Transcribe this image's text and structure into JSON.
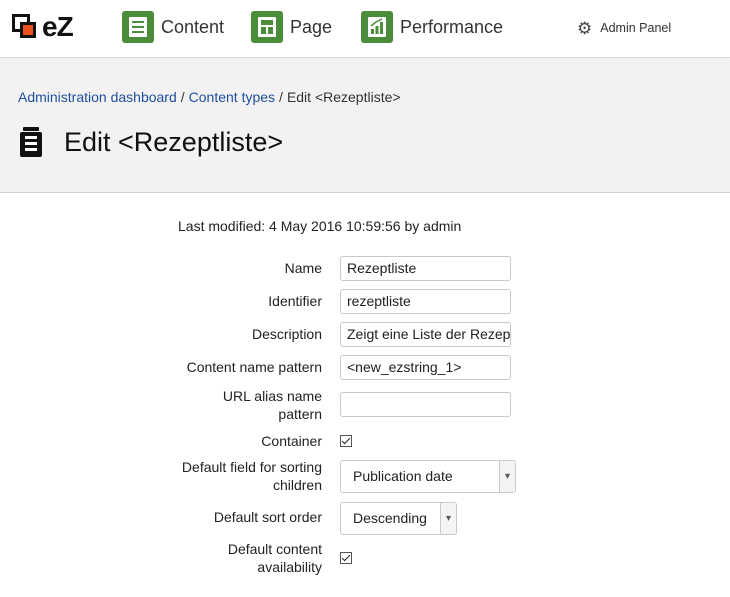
{
  "nav": {
    "logo_text": "eZ",
    "items": [
      {
        "label": "Content",
        "icon": "document-list-icon"
      },
      {
        "label": "Page",
        "icon": "page-layout-icon"
      },
      {
        "label": "Performance",
        "icon": "chart-icon"
      }
    ],
    "admin_label": "Admin Panel",
    "colors": {
      "nav_icon_bg": "#4b8c3a",
      "logo_accent": "#e8531e",
      "link": "#1f4f9c"
    }
  },
  "breadcrumb": {
    "items": [
      "Administration dashboard",
      "Content types"
    ],
    "current": "Edit <Rezeptliste>",
    "separator": "/"
  },
  "page": {
    "title": "Edit <Rezeptliste>",
    "last_modified": "Last modified: 4 May 2016 10:59:56 by admin"
  },
  "form": {
    "name": {
      "label": "Name",
      "value": "Rezeptliste"
    },
    "identifier": {
      "label": "Identifier",
      "value": "rezeptliste"
    },
    "description": {
      "label": "Description",
      "value": "Zeigt eine Liste der Rezepte"
    },
    "content_name_pattern": {
      "label": "Content name pattern",
      "value": "<new_ezstring_1>"
    },
    "url_alias": {
      "label_line1": "URL alias name",
      "label_line2": "pattern",
      "value": ""
    },
    "container": {
      "label": "Container",
      "checked": true
    },
    "sort_field": {
      "label_line1": "Default field for sorting",
      "label_line2": "children",
      "value": "Publication date"
    },
    "sort_order": {
      "label": "Default sort order",
      "value": "Descending"
    },
    "availability": {
      "label_line1": "Default content",
      "label_line2": "availability",
      "checked": true
    }
  }
}
